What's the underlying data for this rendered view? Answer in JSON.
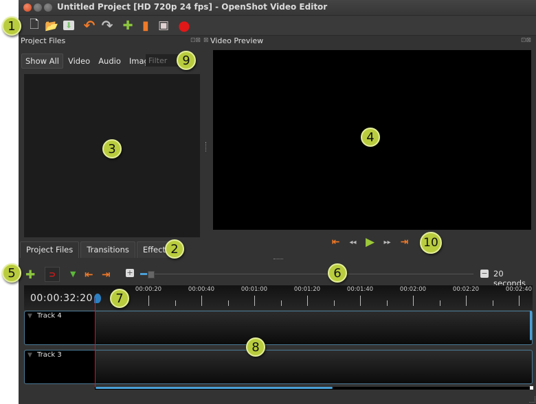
{
  "window": {
    "title": "Untitled Project [HD 720p 24 fps] - OpenShot Video Editor"
  },
  "toolbar": {
    "items": [
      {
        "icon": "new-project-icon",
        "glyph": "🗋"
      },
      {
        "icon": "open-project-icon",
        "glyph": "📂"
      },
      {
        "icon": "save-project-icon",
        "glyph": "⬇"
      },
      {
        "icon": "undo-icon",
        "glyph": "↶"
      },
      {
        "icon": "redo-icon",
        "glyph": "↷"
      },
      {
        "icon": "import-files-icon",
        "glyph": "✚"
      },
      {
        "icon": "choose-profile-icon",
        "glyph": "▮"
      },
      {
        "icon": "fullscreen-icon",
        "glyph": "▣"
      },
      {
        "icon": "export-video-icon",
        "glyph": "●"
      }
    ]
  },
  "project_files": {
    "title": "Project Files",
    "filters": [
      "Show All",
      "Video",
      "Audio",
      "Image"
    ],
    "active_filter": "Show All",
    "filter_placeholder": "Filter"
  },
  "video_preview": {
    "title": "Video Preview"
  },
  "bottom_tabs": [
    "Project Files",
    "Transitions",
    "Effects"
  ],
  "active_tab": "Project Files",
  "playback_controls": [
    {
      "icon": "jump-start-icon",
      "glyph": "⇤"
    },
    {
      "icon": "rewind-icon",
      "glyph": "◂◂"
    },
    {
      "icon": "play-icon",
      "glyph": "▶"
    },
    {
      "icon": "fast-forward-icon",
      "glyph": "▸▸"
    },
    {
      "icon": "jump-end-icon",
      "glyph": "⇥"
    }
  ],
  "timeline_toolbar": {
    "add_track_glyph": "✚",
    "snapping_glyph": "⊃",
    "add_marker_glyph": "▼",
    "prev_marker_glyph": "⇤",
    "next_marker_glyph": "⇥",
    "zoom_in_glyph": "+",
    "zoom_out_glyph": "−",
    "zoom_value_fraction": 0.02,
    "zoom_label": "20 seconds"
  },
  "timeline": {
    "timecode": "00:00:32:20",
    "ruler_labels": [
      "00:00:20",
      "00:00:40",
      "00:01:00",
      "00:01:20",
      "00:01:40",
      "00:02:00",
      "00:02:20",
      "00:02:40"
    ],
    "tracks": [
      {
        "name": "Track 4"
      },
      {
        "name": "Track 3"
      }
    ]
  },
  "callouts": [
    "1",
    "2",
    "3",
    "4",
    "5",
    "6",
    "7",
    "8",
    "9",
    "10"
  ],
  "colors": {
    "accent_blue": "#4aa0d8",
    "callout_green": "#b9cc3e",
    "playhead_red": "#c8182f"
  }
}
